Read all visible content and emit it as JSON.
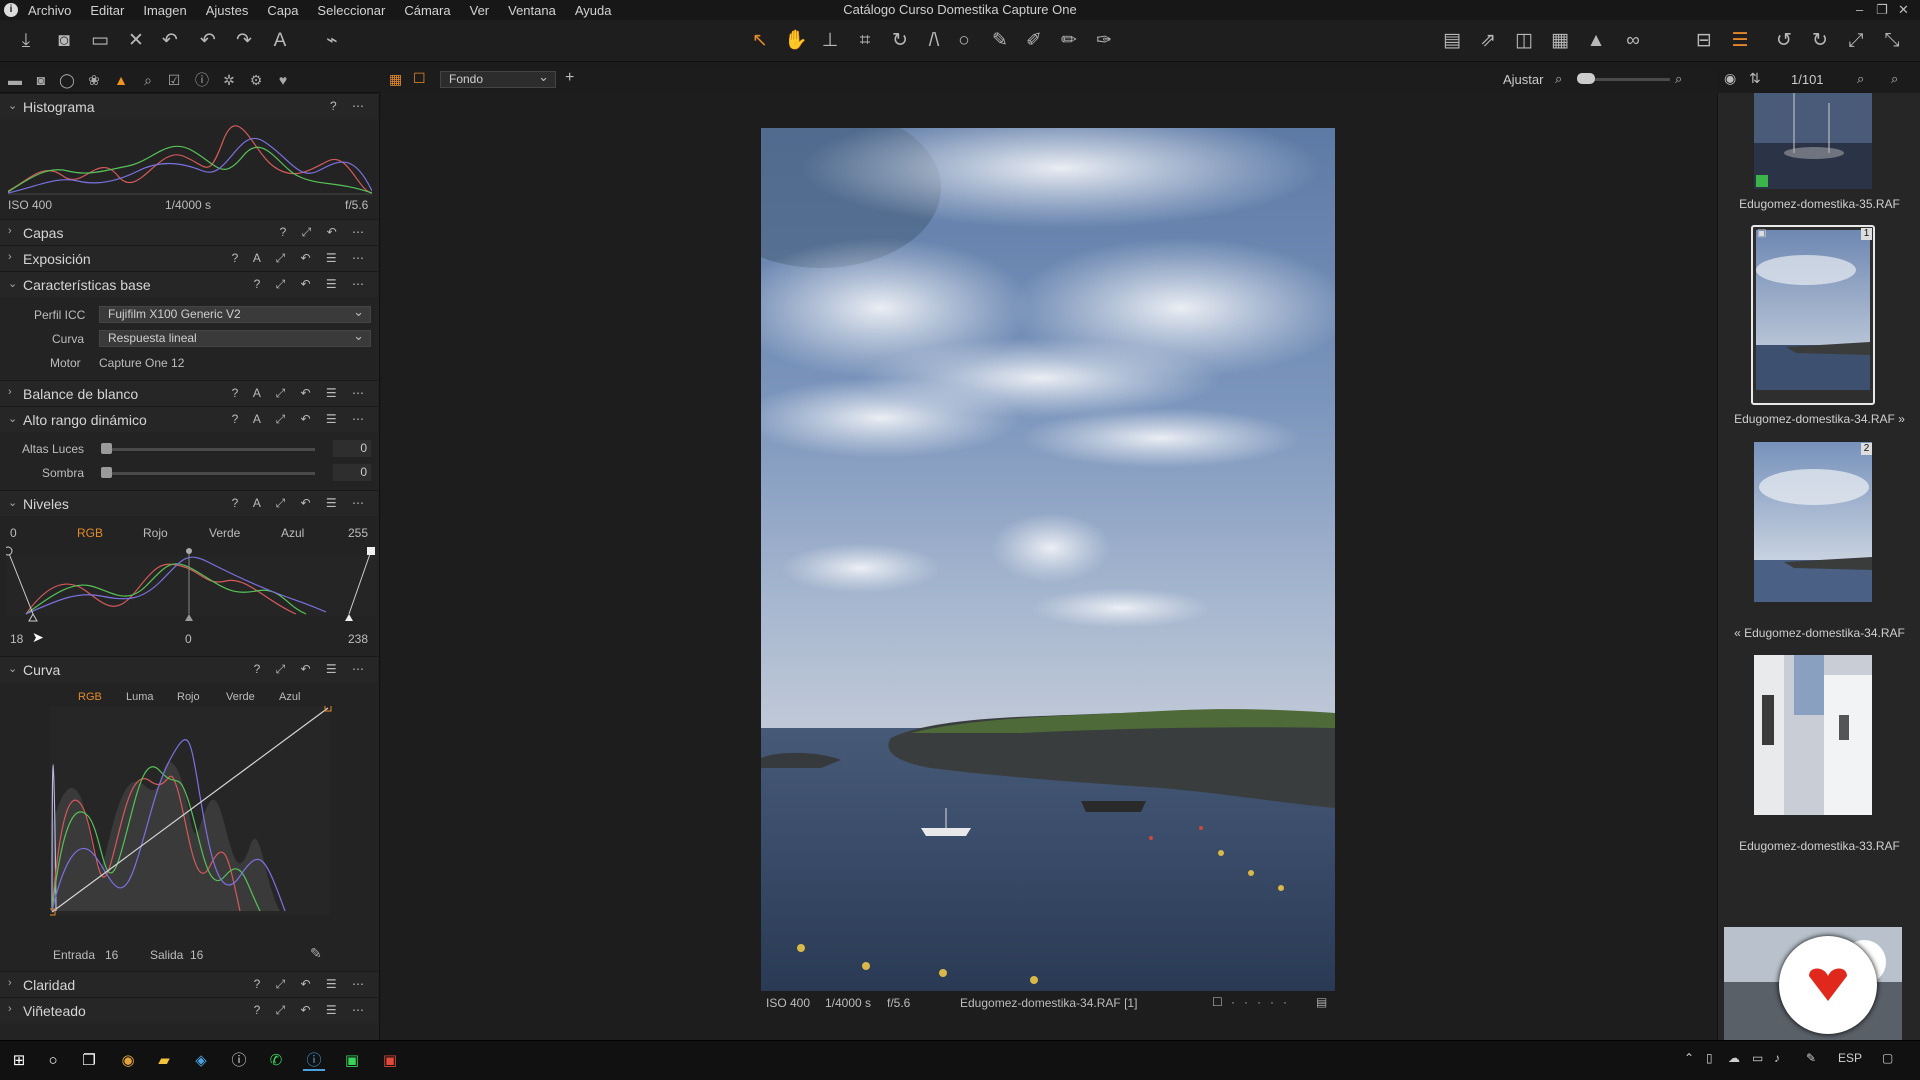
{
  "menubar": {
    "items": [
      "Archivo",
      "Editar",
      "Imagen",
      "Ajustes",
      "Capa",
      "Seleccionar",
      "Cámara",
      "Ver",
      "Ventana",
      "Ayuda"
    ],
    "title": "Catálogo Curso Domestika Capture One"
  },
  "viewer_toolbar": {
    "variant_select": "Fondo",
    "fit_label": "Ajustar",
    "counter": "1/101"
  },
  "panels": {
    "histogram": {
      "title": "Histograma",
      "iso": "ISO 400",
      "shutter": "1/4000 s",
      "aperture": "f/5.6"
    },
    "layers": {
      "title": "Capas"
    },
    "exposure": {
      "title": "Exposición"
    },
    "base": {
      "title": "Características base",
      "icc_label": "Perfil ICC",
      "icc_value": "Fujifilm X100 Generic V2",
      "curve_label": "Curva",
      "curve_value": "Respuesta lineal",
      "engine_label": "Motor",
      "engine_value": "Capture One 12"
    },
    "wb": {
      "title": "Balance de blanco"
    },
    "hdr": {
      "title": "Alto rango dinámico",
      "highlights_label": "Altas Luces",
      "highlights_value": "0",
      "shadows_label": "Sombra",
      "shadows_value": "0"
    },
    "levels": {
      "title": "Niveles",
      "out_min": "0",
      "out_max": "255",
      "tabs": [
        "RGB",
        "Rojo",
        "Verde",
        "Azul"
      ],
      "in_min": "18",
      "mid": "0",
      "in_max": "238"
    },
    "curve": {
      "title": "Curva",
      "tabs": [
        "RGB",
        "Luma",
        "Rojo",
        "Verde",
        "Azul"
      ],
      "input_label": "Entrada",
      "input_value": "16",
      "output_label": "Salida",
      "output_value": "16"
    },
    "clarity": {
      "title": "Claridad"
    },
    "vignette": {
      "title": "Viñeteado"
    }
  },
  "photo_info": {
    "iso": "ISO 400",
    "shutter": "1/4000 s",
    "aperture": "f/5.6",
    "filename": "Edugomez-domestika-34.RAF [1]"
  },
  "browser": {
    "thumbs": [
      {
        "caption": "Edugomez-domestika-35.RAF"
      },
      {
        "caption": "Edugomez-domestika-34.RAF »",
        "badge": "1"
      },
      {
        "caption": "« Edugomez-domestika-34.RAF",
        "badge": "2"
      },
      {
        "caption": "Edugomez-domestika-33.RAF"
      }
    ]
  },
  "taskbar": {
    "lang": "ESP"
  },
  "colors": {
    "accent": "#e3892a",
    "panel": "#232323",
    "viewer": "#1d1d1d",
    "brand_red": "#e0281c"
  }
}
